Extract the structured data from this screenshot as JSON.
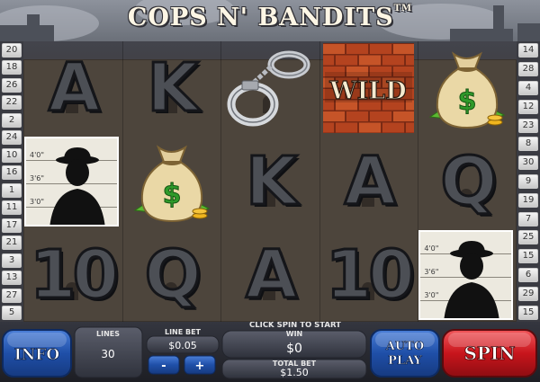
{
  "game": {
    "title": "COPS N' BANDITS",
    "trademark": "TM"
  },
  "paylines": {
    "left": [
      "20",
      "18",
      "26",
      "22",
      "2",
      "24",
      "10",
      "16",
      "1",
      "11",
      "17",
      "21",
      "3",
      "13",
      "27",
      "5"
    ],
    "right": [
      "14",
      "28",
      "4",
      "12",
      "23",
      "8",
      "30",
      "9",
      "19",
      "7",
      "25",
      "15",
      "6",
      "29",
      "15"
    ]
  },
  "reels": [
    [
      "A",
      "mugshot",
      "10"
    ],
    [
      "K",
      "money-bag",
      "Q"
    ],
    [
      "handcuffs",
      "K",
      "A"
    ],
    [
      "WILD",
      "A",
      "10"
    ],
    [
      "money-bag",
      "Q",
      "mugshot"
    ]
  ],
  "symbols": {
    "wild_label": "WILD",
    "dollar_sign": "$",
    "mug_labels": [
      "4'0\"",
      "3'6\"",
      "3'0\""
    ]
  },
  "controls": {
    "info_label": "INFO",
    "lines_label": "LINES",
    "lines_value": "30",
    "line_bet_label": "LINE  BET",
    "line_bet_value": "$0.05",
    "minus_label": "-",
    "plus_label": "+",
    "message": "CLICK SPIN TO START",
    "win_label": "WIN",
    "win_value": "$0",
    "total_bet_label": "TOTAL BET",
    "total_bet_value": "$1.50",
    "autoplay_line1": "AUTO",
    "autoplay_line2": "PLAY",
    "spin_label": "SPIN"
  },
  "colors": {
    "info_blue": "#1f4fa8",
    "spin_red": "#c8151c",
    "panel": "#3b3e4a"
  }
}
